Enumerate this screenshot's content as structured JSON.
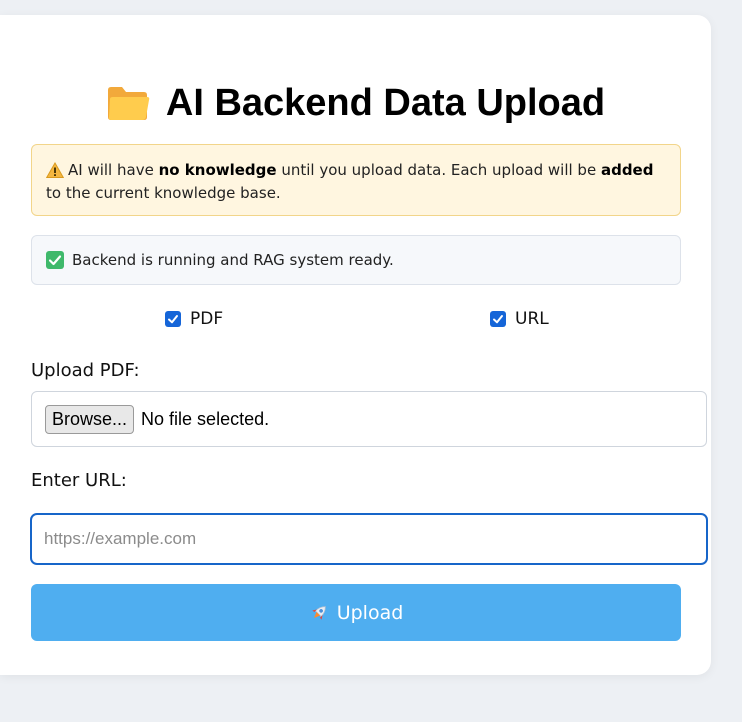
{
  "title": {
    "icon": "folder-icon",
    "text": "AI Backend Data Upload"
  },
  "warning": {
    "icon": "warning-icon",
    "part1": "AI will have ",
    "bold1": "no knowledge",
    "part2": " until you upload data. Each upload will be ",
    "bold2": "added",
    "part3": " to the current knowledge base."
  },
  "status": {
    "icon": "check-mark-icon",
    "text": "Backend is running and RAG system ready."
  },
  "sources": [
    {
      "label": "PDF",
      "checked": true
    },
    {
      "label": "URL",
      "checked": true
    }
  ],
  "pdf": {
    "label": "Upload PDF:",
    "browse_label": "Browse...",
    "file_status": "No file selected."
  },
  "url": {
    "label": "Enter URL:",
    "placeholder": "https://example.com",
    "value": ""
  },
  "upload": {
    "icon": "rocket-icon",
    "label": "Upload"
  },
  "colors": {
    "accent": "#1565d8",
    "upload_button": "#4faef0",
    "warning_bg": "#fff6e0",
    "status_ok": "#3fb96b"
  }
}
